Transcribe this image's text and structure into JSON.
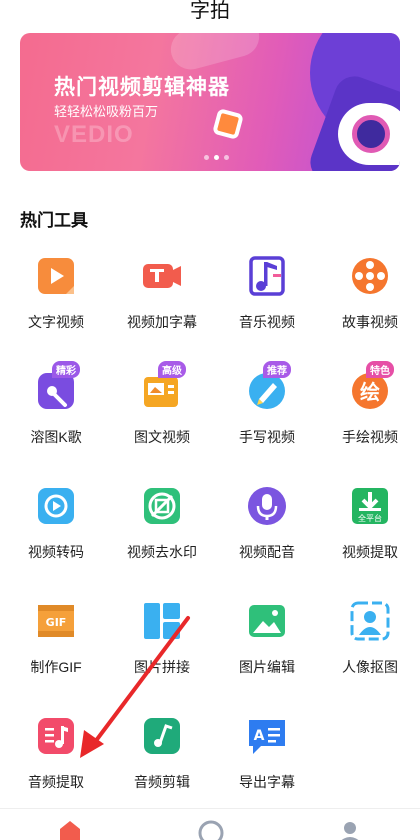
{
  "header": {
    "title": "字拍"
  },
  "banner": {
    "headline": "热门视频剪辑神器",
    "subline": "轻轻松松吸粉百万",
    "watermark": "VEDIO"
  },
  "section": {
    "title": "热门工具"
  },
  "tools": [
    {
      "label": "文字视频",
      "icon": "play-card-icon",
      "color": "#f78c3c"
    },
    {
      "label": "视频加字幕",
      "icon": "text-camera-icon",
      "color": "#f25c4d"
    },
    {
      "label": "音乐视频",
      "icon": "music-note-icon",
      "color": "#5a3fd6"
    },
    {
      "label": "故事视频",
      "icon": "film-reel-icon",
      "color": "#f5762e"
    },
    {
      "label": "溶图K歌",
      "icon": "microphone-note-icon",
      "color": "#7a4ce0",
      "badge": "精彩",
      "badge_color": "#9b59e8"
    },
    {
      "label": "图文视频",
      "icon": "image-card-icon",
      "color": "#f5a623",
      "badge": "高级",
      "badge_color": "#a85be8"
    },
    {
      "label": "手写视频",
      "icon": "pen-circle-icon",
      "color": "#3ab0f0",
      "badge": "推荐",
      "badge_color": "#a85be8"
    },
    {
      "label": "手绘视频",
      "icon": "paint-circle-icon",
      "color": "#f5762e",
      "badge": "特色",
      "badge_color": "#e64fa6",
      "glyph": "绘"
    },
    {
      "label": "视频转码",
      "icon": "video-convert-icon",
      "color": "#3ab0f0"
    },
    {
      "label": "视频去水印",
      "icon": "no-watermark-icon",
      "color": "#2fc07a"
    },
    {
      "label": "视频配音",
      "icon": "microphone-icon",
      "color": "#7b55e0"
    },
    {
      "label": "视频提取",
      "icon": "download-icon",
      "color": "#24b561",
      "caption": "全平台"
    },
    {
      "label": "制作GIF",
      "icon": "gif-icon",
      "color": "#f5a03a",
      "caption": "GIF"
    },
    {
      "label": "图片拼接",
      "icon": "image-grid-icon",
      "color": "#3ab0f0"
    },
    {
      "label": "图片编辑",
      "icon": "image-edit-icon",
      "color": "#2fc07a"
    },
    {
      "label": "人像抠图",
      "icon": "portrait-cutout-icon",
      "color": "#3ab0f0"
    },
    {
      "label": "音频提取",
      "icon": "audio-extract-icon",
      "color": "#f24b6a"
    },
    {
      "label": "音频剪辑",
      "icon": "audio-edit-icon",
      "color": "#1faa7a"
    },
    {
      "label": "导出字幕",
      "icon": "subtitle-export-icon",
      "color": "#2e7cf0",
      "caption": "A"
    }
  ],
  "annotation": {
    "arrow_color": "#e8282a"
  },
  "nav": [
    {
      "icon": "home-icon",
      "color": "#f25c4d"
    },
    {
      "icon": "discover-icon",
      "color": "#9aa3b2"
    },
    {
      "icon": "profile-icon",
      "color": "#9aa3b2"
    }
  ]
}
